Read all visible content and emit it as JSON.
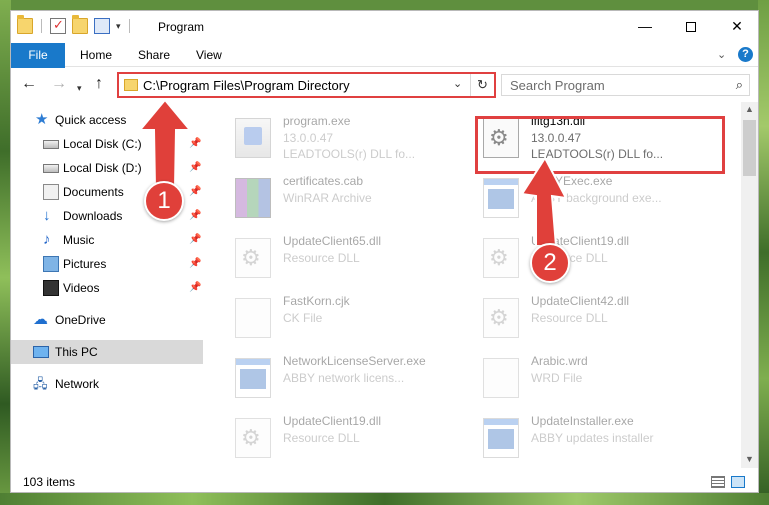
{
  "window": {
    "title": "Program",
    "controls": {
      "minimize": "—",
      "maximize": "",
      "close": "✕"
    }
  },
  "ribbon": {
    "tabs": [
      "File",
      "Home",
      "Share",
      "View"
    ],
    "chevron": "⌄",
    "help": "?"
  },
  "address": {
    "back": "←",
    "forward": "→",
    "recent": "▾",
    "up": "↑",
    "path": "C:\\Program Files\\Program Directory",
    "dropdown": "⌄",
    "refresh": "↻",
    "search_placeholder": "Search Program",
    "search_icon": "⌕"
  },
  "nav": {
    "items": [
      {
        "label": "Quick access",
        "icon": "star-icon"
      },
      {
        "label": "Local Disk (C:)",
        "icon": "disk-icon",
        "pinned": true
      },
      {
        "label": "Local Disk (D:)",
        "icon": "disk-icon",
        "pinned": true
      },
      {
        "label": "Documents",
        "icon": "document-icon",
        "pinned": true
      },
      {
        "label": "Downloads",
        "icon": "download-icon",
        "pinned": true
      },
      {
        "label": "Music",
        "icon": "music-icon",
        "pinned": true
      },
      {
        "label": "Pictures",
        "icon": "pictures-icon",
        "pinned": true
      },
      {
        "label": "Videos",
        "icon": "videos-icon",
        "pinned": true
      },
      {
        "label": "OneDrive",
        "icon": "cloud-icon"
      },
      {
        "label": "This PC",
        "icon": "computer-icon",
        "selected": true
      },
      {
        "label": "Network",
        "icon": "network-icon"
      }
    ],
    "pin_glyph": "📌"
  },
  "files": [
    {
      "name": "program.exe",
      "line2": "13.0.0.47",
      "line3": "LEADTOOLS(r) DLL fo...",
      "icon": "program-icon",
      "faded": true
    },
    {
      "name": "lfitg13n.dll",
      "line2": "13.0.0.47",
      "line3": "LEADTOOLS(r) DLL fo...",
      "icon": "dll-icon",
      "faded": false
    },
    {
      "name": "certificates.cab",
      "line2": "WinRAR Archive",
      "line3": "",
      "icon": "archive-icon",
      "faded": true
    },
    {
      "name": "ABBYExec.exe",
      "line2": "ABBY background exe...",
      "line3": "",
      "icon": "exe-icon",
      "faded": true
    },
    {
      "name": "UpdateClient65.dll",
      "line2": "Resource DLL",
      "line3": "",
      "icon": "dll-icon",
      "faded": true
    },
    {
      "name": "UpdateClient19.dll",
      "line2": "Resource DLL",
      "line3": "",
      "icon": "dll-icon",
      "faded": true
    },
    {
      "name": "FastKorn.cjk",
      "line2": "CK File",
      "line3": "",
      "icon": "file-icon",
      "faded": true
    },
    {
      "name": "UpdateClient42.dll",
      "line2": "Resource DLL",
      "line3": "",
      "icon": "dll-icon",
      "faded": true
    },
    {
      "name": "NetworkLicenseServer.exe",
      "line2": "ABBY network licens...",
      "line3": "",
      "icon": "exe-icon",
      "faded": true
    },
    {
      "name": "Arabic.wrd",
      "line2": "WRD File",
      "line3": "",
      "icon": "file-icon",
      "faded": true
    },
    {
      "name": "UpdateClient19.dll",
      "line2": "Resource DLL",
      "line3": "",
      "icon": "dll-icon",
      "faded": true
    },
    {
      "name": "UpdateInstaller.exe",
      "line2": "ABBY updates installer",
      "line3": "",
      "icon": "exe-icon",
      "faded": true
    }
  ],
  "status": {
    "item_count": "103 items"
  },
  "annotations": {
    "step1": "1",
    "step2": "2",
    "color": "#e0403a"
  }
}
